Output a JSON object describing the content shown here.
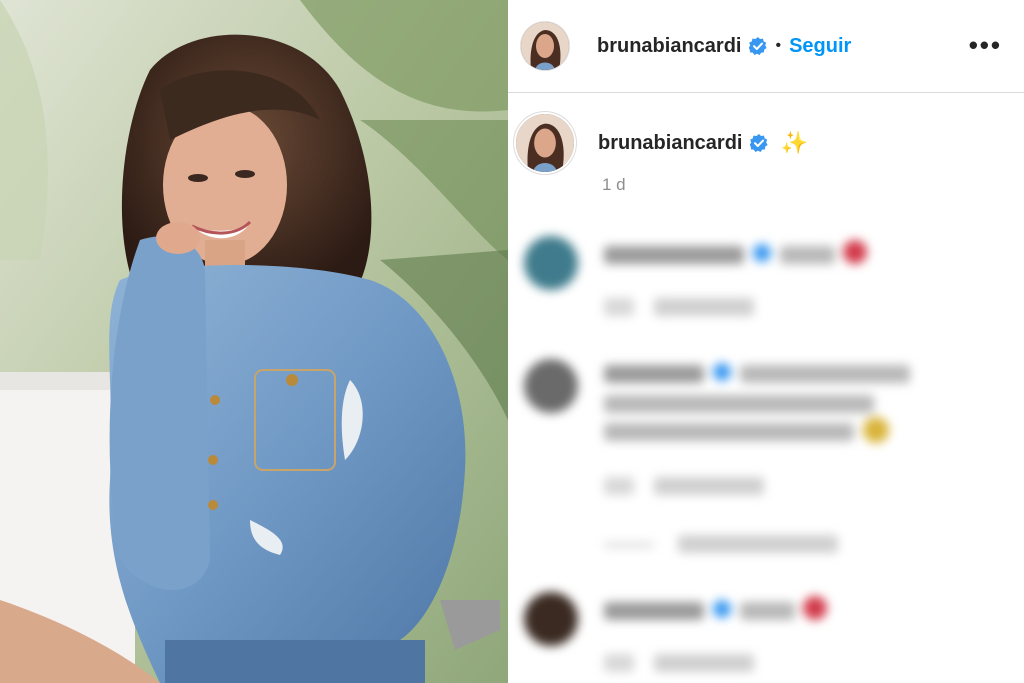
{
  "post": {
    "username": "brunabiancardi",
    "follow_label": "Seguir",
    "separator": "•",
    "more_label": "•••",
    "caption_emoji": "✨",
    "age": "1 d"
  },
  "colors": {
    "link_blue": "#0095f6",
    "verified_blue": "#3897f0",
    "text_dark": "#262626",
    "meta_gray": "#8e8e8e",
    "divider": "#dbdbdb"
  },
  "icons": [
    "verified-badge-icon",
    "more-options-icon",
    "sparkle-emoji-icon"
  ]
}
